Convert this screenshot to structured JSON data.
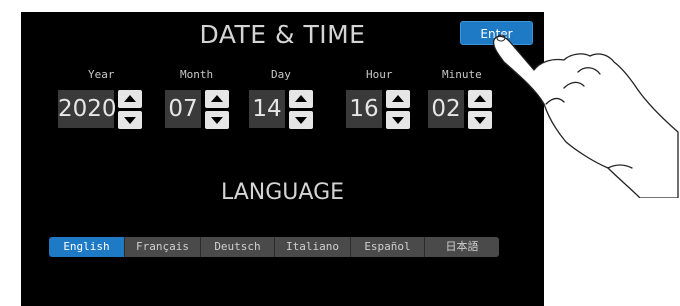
{
  "screen": {
    "title": "DATE & TIME",
    "enter_label": "Enter",
    "fields": [
      {
        "label": "Year",
        "value": "2020"
      },
      {
        "label": "Month",
        "value": "07"
      },
      {
        "label": "Day",
        "value": "14"
      },
      {
        "label": "Hour",
        "value": "16"
      },
      {
        "label": "Minute",
        "value": "02"
      }
    ],
    "language_title": "LANGUAGE",
    "languages": [
      {
        "label": "English",
        "selected": true
      },
      {
        "label": "Français",
        "selected": false
      },
      {
        "label": "Deutsch",
        "selected": false
      },
      {
        "label": "Italiano",
        "selected": false
      },
      {
        "label": "Español",
        "selected": false
      },
      {
        "label": "日本語",
        "selected": false
      }
    ],
    "colors": {
      "accent": "#1f7ac6",
      "background": "#000000",
      "field_bg": "#3a3a3a"
    }
  },
  "icons": {
    "up": "up-arrow-icon",
    "down": "down-arrow-icon",
    "hand": "pointing-hand-icon"
  }
}
